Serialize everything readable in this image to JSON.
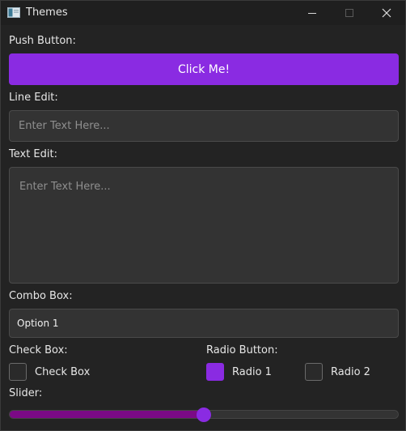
{
  "window": {
    "title": "Themes",
    "icons": {
      "app": "app-window-icon",
      "minimize": "minimize-icon",
      "maximize": "maximize-icon",
      "close": "close-icon"
    }
  },
  "push_button": {
    "label": "Push Button:",
    "text": "Click Me!"
  },
  "line_edit": {
    "label": "Line Edit:",
    "value": "",
    "placeholder": "Enter Text Here..."
  },
  "text_edit": {
    "label": "Text Edit:",
    "value": "",
    "placeholder": "Enter Text Here..."
  },
  "combo_box": {
    "label": "Combo Box:",
    "selected": "Option 1"
  },
  "check_box": {
    "label": "Check Box:",
    "option_label": "Check Box",
    "checked": false
  },
  "radio_button": {
    "label": "Radio Button:",
    "options": [
      {
        "label": "Radio 1",
        "selected": true
      },
      {
        "label": "Radio 2",
        "selected": false
      }
    ]
  },
  "slider": {
    "label": "Slider:",
    "value_fraction": 0.5
  },
  "colors": {
    "accent": "#8a2be2",
    "slider_fill": "#7b0a86",
    "background": "#232323",
    "field_background": "#333333"
  }
}
